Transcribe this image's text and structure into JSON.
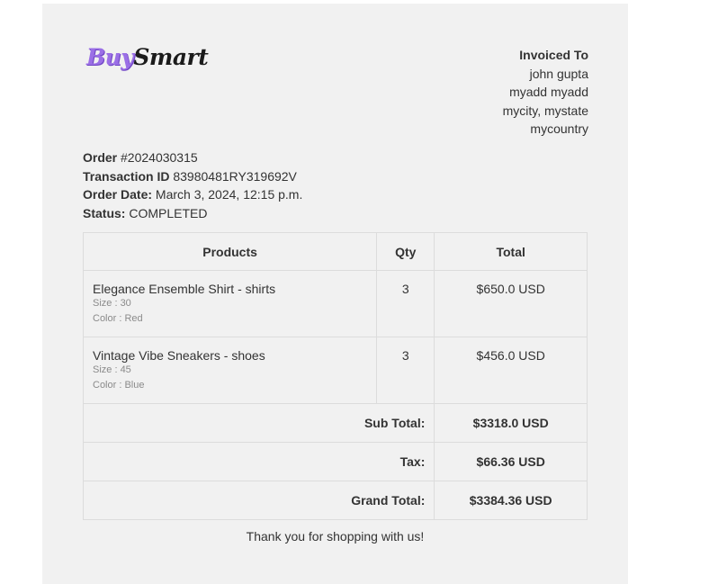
{
  "brand": {
    "part1": "Buy",
    "part2": "Smart"
  },
  "invoiced_to": {
    "title": "Invoiced To",
    "lines": [
      "john gupta",
      "myadd myadd",
      "mycity, mystate",
      "mycountry"
    ]
  },
  "order": {
    "order_label": "Order",
    "order_number": "#2024030315",
    "transaction_label": "Transaction ID",
    "transaction_id": "83980481RY319692V",
    "date_label": "Order Date:",
    "date": "March 3, 2024, 12:15 p.m.",
    "status_label": "Status:",
    "status": "COMPLETED"
  },
  "table": {
    "headers": {
      "products": "Products",
      "qty": "Qty",
      "total": "Total"
    },
    "items": [
      {
        "name": "Elegance Ensemble Shirt - shirts",
        "size": "Size : 30",
        "color": "Color : Red",
        "qty": "3",
        "total": "$650.0 USD"
      },
      {
        "name": "Vintage Vibe Sneakers - shoes",
        "size": "Size : 45",
        "color": "Color : Blue",
        "qty": "3",
        "total": "$456.0 USD"
      }
    ],
    "summary": {
      "subtotal_label": "Sub Total:",
      "subtotal": "$3318.0 USD",
      "tax_label": "Tax:",
      "tax": "$66.36 USD",
      "grand_label": "Grand Total:",
      "grand": "$3384.36 USD"
    }
  },
  "footer": {
    "thanks": "Thank you for shopping with us!"
  }
}
